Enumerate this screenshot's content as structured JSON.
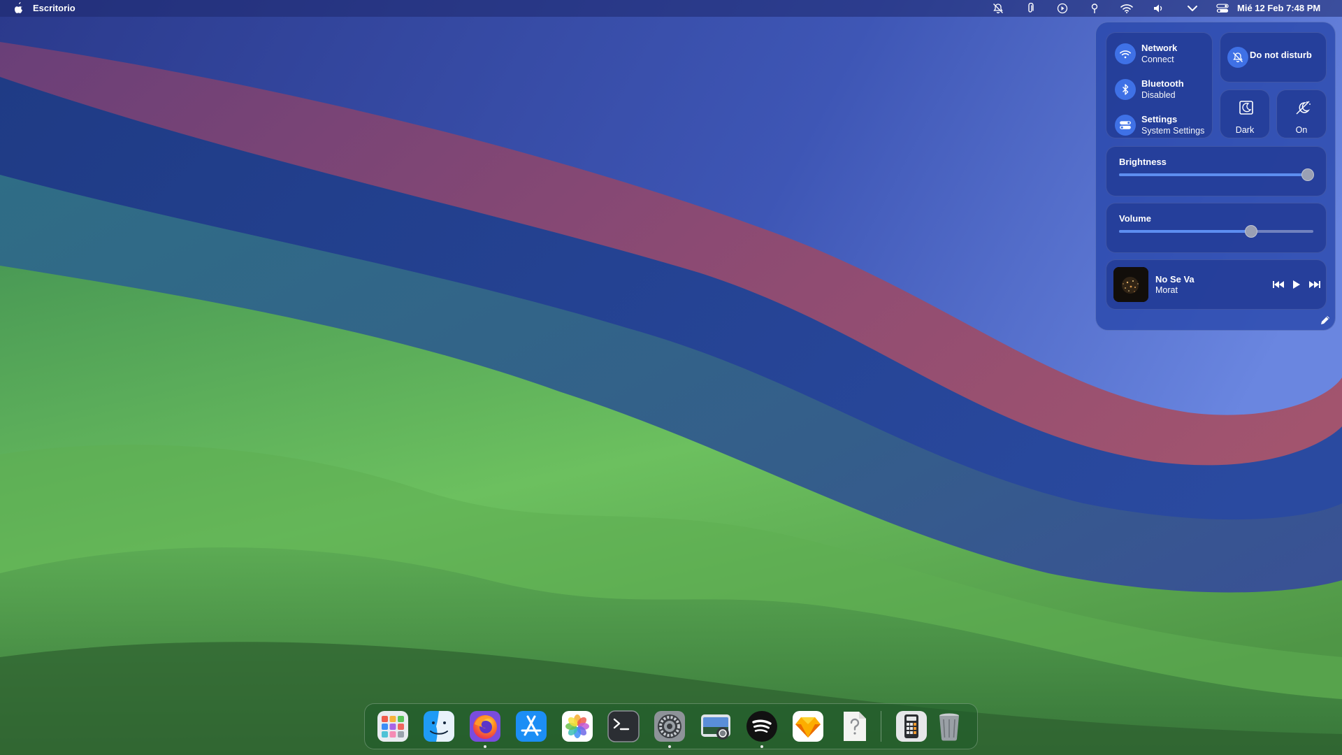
{
  "menubar": {
    "app_name": "Escritorio",
    "clock": "Mié 12 Feb  7:48 PM",
    "icons": [
      "apple-logo-icon",
      "notifications-off-icon",
      "paperclip-icon",
      "play-circle-icon",
      "location-pin-icon",
      "wifi-icon",
      "volume-icon",
      "chevron-down-icon",
      "control-center-icon"
    ]
  },
  "control_center": {
    "network": {
      "title": "Network",
      "subtitle": "Connect",
      "icon": "wifi-icon"
    },
    "bluetooth": {
      "title": "Bluetooth",
      "subtitle": "Disabled",
      "icon": "bluetooth-icon"
    },
    "settings": {
      "title": "Settings",
      "subtitle": "System Settings",
      "icon": "toggle-icon"
    },
    "do_not_disturb": {
      "label": "Do not disturb",
      "icon": "notifications-off-icon"
    },
    "dark_mode": {
      "label": "Dark",
      "icon": "dark-mode-icon"
    },
    "night_light": {
      "label": "On",
      "icon": "night-light-icon"
    },
    "brightness": {
      "label": "Brightness",
      "value": 0.97
    },
    "volume": {
      "label": "Volume",
      "value": 0.68
    },
    "now_playing": {
      "title": "No Se Va",
      "artist": "Morat"
    },
    "edit_icon": "pencil-icon"
  },
  "dock": {
    "items": [
      {
        "name": "launchpad",
        "running": false
      },
      {
        "name": "finder",
        "running": false
      },
      {
        "name": "firefox",
        "running": true
      },
      {
        "name": "app-store",
        "running": false
      },
      {
        "name": "photos",
        "running": false
      },
      {
        "name": "terminal",
        "running": false
      },
      {
        "name": "system-settings",
        "running": true
      },
      {
        "name": "screenshot",
        "running": false
      },
      {
        "name": "spotify",
        "running": true
      },
      {
        "name": "sketch",
        "running": false
      },
      {
        "name": "help-document",
        "running": false
      },
      {
        "name": "calculator",
        "running": false
      },
      {
        "name": "trash",
        "running": false
      }
    ]
  },
  "colors": {
    "accent": "#3f71e6",
    "panel": "#2b4aa8",
    "dock": "#1e5a28"
  }
}
